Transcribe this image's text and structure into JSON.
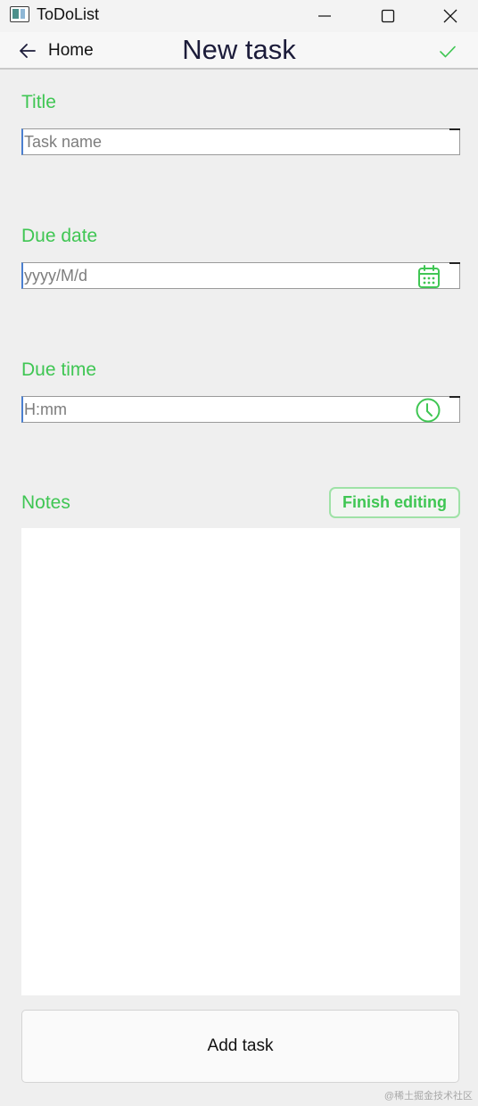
{
  "window": {
    "title": "ToDoList"
  },
  "nav": {
    "back_label": "Home",
    "page_title": "New task"
  },
  "form": {
    "title_label": "Title",
    "title_placeholder": "Task name",
    "due_date_label": "Due date",
    "due_date_placeholder": "yyyy/M/d",
    "due_time_label": "Due time",
    "due_time_placeholder": "H:mm",
    "notes_label": "Notes",
    "finish_editing_label": "Finish editing",
    "add_task_label": "Add task"
  },
  "watermark": "@稀土掘金技术社区",
  "colors": {
    "accent": "#3fc653",
    "border": "#9a9a9a",
    "background": "#efefef"
  },
  "icons": {
    "app": "app-window-icon",
    "minimize": "minimize-icon",
    "maximize": "maximize-icon",
    "close": "close-icon",
    "back": "arrow-left-icon",
    "confirm": "checkmark-icon",
    "calendar": "calendar-icon",
    "clock": "clock-icon"
  }
}
